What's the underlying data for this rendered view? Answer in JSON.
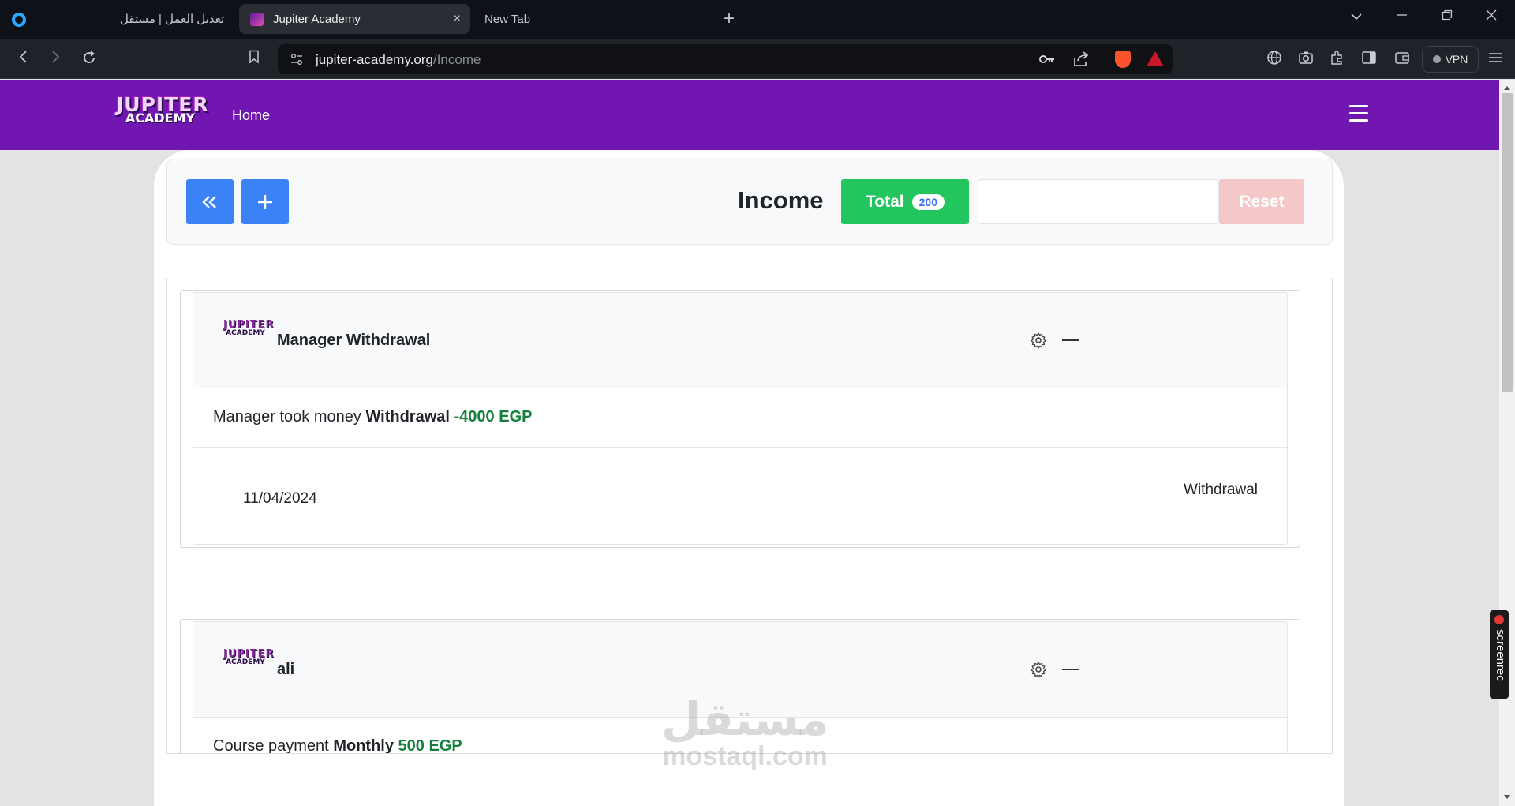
{
  "browser": {
    "tabs": [
      {
        "title": "تعديل العمل | مستقل"
      },
      {
        "title": "Jupiter Academy"
      },
      {
        "title": "New Tab"
      }
    ],
    "url_host": "jupiter-academy.org",
    "url_path": "/Income",
    "vpn_label": "VPN",
    "new_tab_symbol": "+",
    "close_symbol": "×"
  },
  "navbar": {
    "logo_line1": "JUPITER",
    "logo_line2": "ACADEMY",
    "home_label": "Home"
  },
  "toolbar": {
    "back_symbol": "⏪",
    "add_symbol": "+",
    "title": "Income",
    "total_label": "Total",
    "total_count": "200",
    "search_value": "",
    "reset_label": "Reset"
  },
  "cards": [
    {
      "title": "Manager Withdrawal",
      "text_prefix": "Manager took money",
      "text_type": "Withdrawal",
      "amount": "-4000 EGP",
      "date": "11/04/2024",
      "category": "Withdrawal"
    },
    {
      "title": "ali",
      "text_prefix": "Course payment",
      "text_type": "Monthly",
      "amount": "500 EGP"
    }
  ],
  "overlays": {
    "screenrec_label": "screenrec",
    "watermark_arabic": "مستقل",
    "watermark_domain": "mostaql.com"
  },
  "colors": {
    "navbar": "#7216b1",
    "primary_button": "#3b82f6",
    "total_button": "#22c55e",
    "reset_button": "#f4c7c8",
    "amount_green": "#15803d"
  },
  "icons": [
    "brave-icon",
    "gear-icon",
    "hamburger-icon",
    "key-icon",
    "share-icon",
    "globe-icon",
    "camera-icon",
    "puzzle-icon",
    "sidebar-icon",
    "wallet-icon",
    "bookmark-icon"
  ]
}
